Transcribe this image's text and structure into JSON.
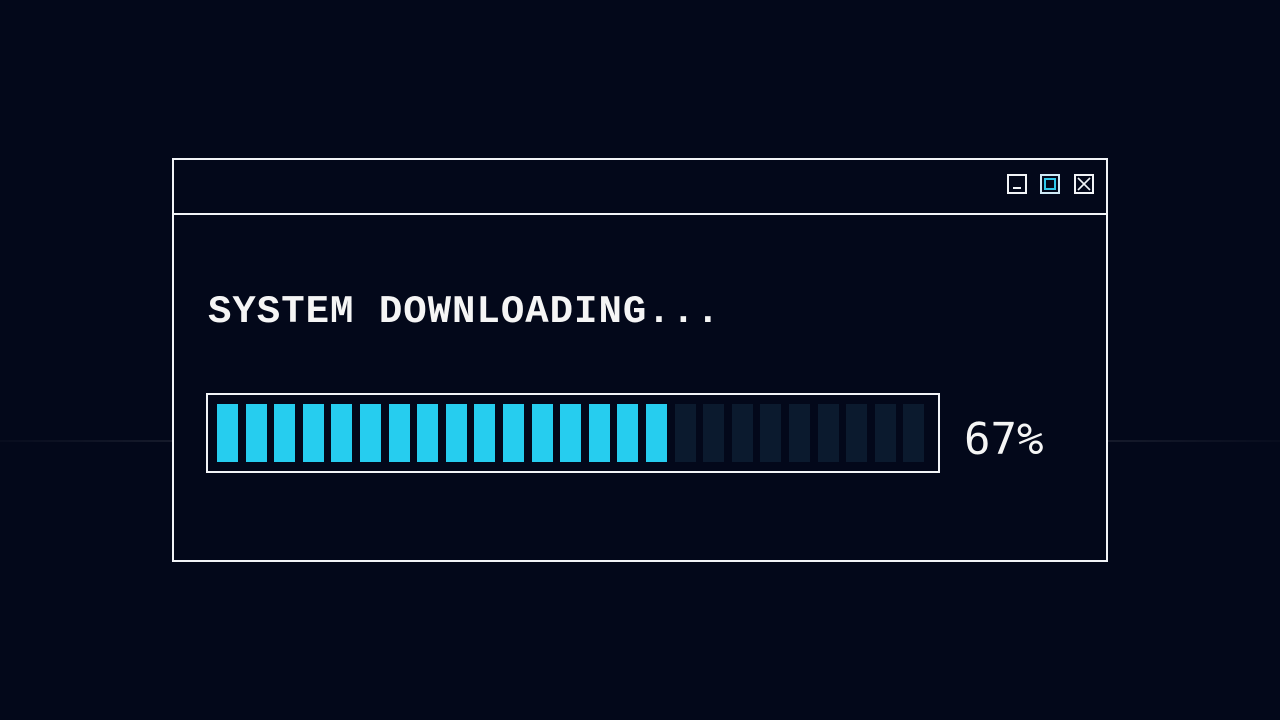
{
  "dialog": {
    "heading": "SYSTEM DOWNLOADING...",
    "controls": {
      "minimize": "minimize-icon",
      "maximize": "maximize-icon",
      "close": "close-icon"
    }
  },
  "progress": {
    "percent_text": "67%",
    "fraction": 0.67,
    "segments_total": 25,
    "segments_filled": 16
  },
  "colors": {
    "background": "#03081a",
    "border": "#f2f4f7",
    "fill": "#26cdef",
    "empty": "#0b1a2e",
    "text": "#f5f5f5"
  }
}
